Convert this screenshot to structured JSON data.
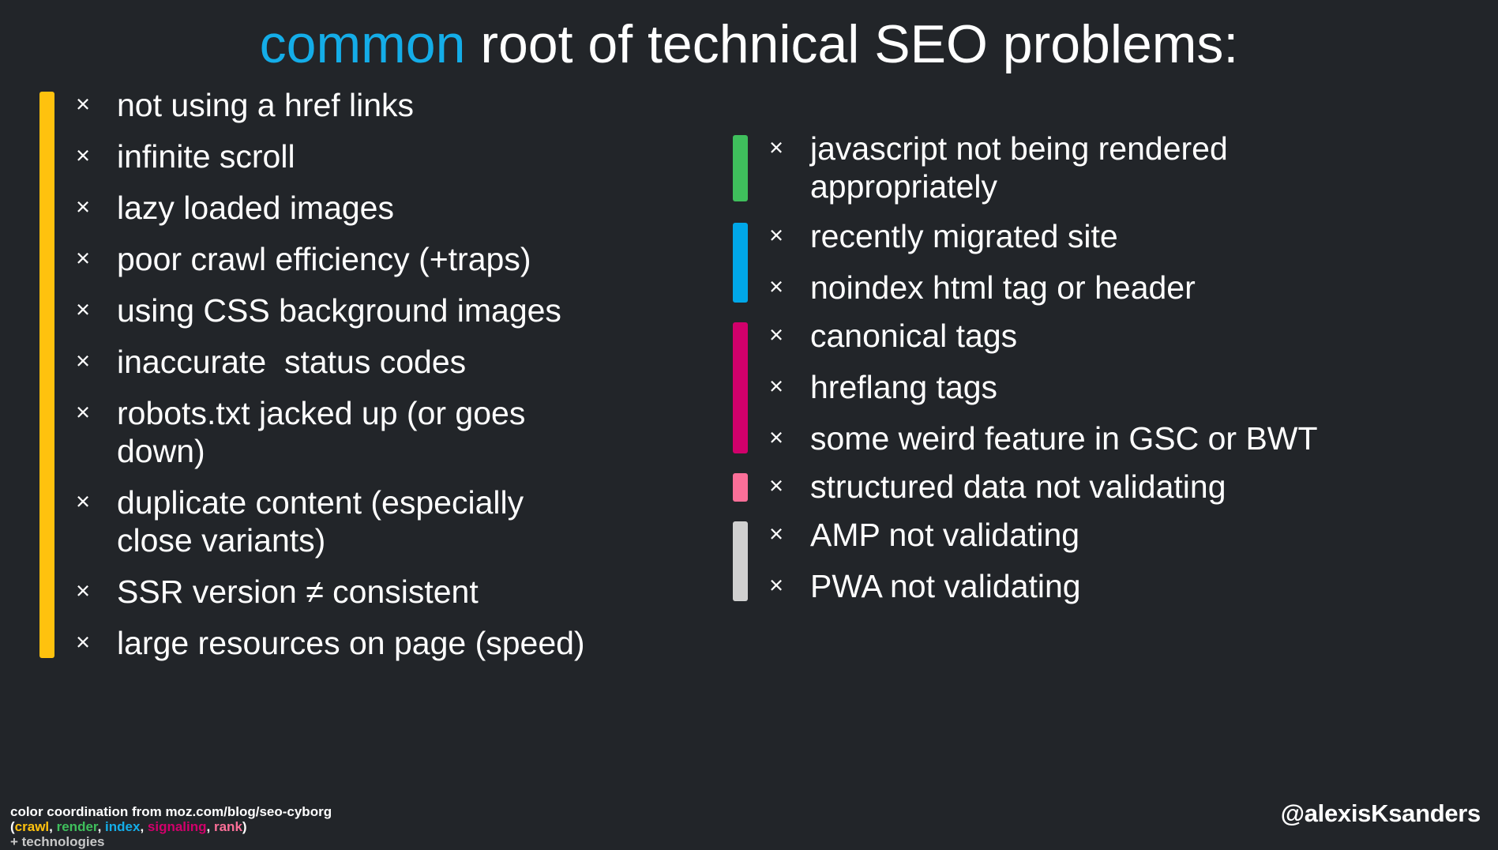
{
  "slide": {
    "background_color": "#222529",
    "title": {
      "highlight": "common",
      "rest": " root of technical SEO problems:",
      "highlight_color": "#14ADE8",
      "text_color": "#ffffff"
    },
    "bullet_mark": "×"
  },
  "left_column": {
    "groups": [
      {
        "bar_color": "#FFC20E",
        "bar_name": "crawl",
        "items": [
          "not using a href links",
          "infinite scroll",
          "lazy loaded images",
          "poor crawl efficiency (+traps)",
          "using CSS background images",
          "inaccurate  status codes",
          "robots.txt jacked up (or goes down)",
          "duplicate content (especially close variants)",
          "SSR version ≠ consistent",
          "large resources on page (speed)"
        ]
      }
    ]
  },
  "right_column": {
    "groups": [
      {
        "bar_color": "#3FBF5C",
        "bar_name": "render",
        "items": [
          "javascript not being rendered appropriately"
        ]
      },
      {
        "bar_color": "#00A7E8",
        "bar_name": "index",
        "items": [
          "recently migrated site",
          "noindex html tag or header"
        ]
      },
      {
        "bar_color": "#D1006B",
        "bar_name": "signaling",
        "items": [
          "canonical tags",
          "hreflang tags",
          "some weird feature in GSC or BWT"
        ]
      },
      {
        "bar_color": "#FB6F98",
        "bar_name": "rank",
        "items": [
          "structured data not validating"
        ]
      },
      {
        "bar_color": "#D0D0D0",
        "bar_name": "technologies",
        "items": [
          "AMP not validating",
          "PWA not validating"
        ]
      }
    ]
  },
  "footer": {
    "credit_prefix": "color coordination from moz.com/blog/seo-cyborg (",
    "credit_crawl": "crawl",
    "credit_sep1": ", ",
    "credit_render": "render",
    "credit_sep2": ", ",
    "credit_index": "index",
    "credit_sep3": ", ",
    "credit_signaling": "signaling",
    "credit_sep4": ", ",
    "credit_rank": "rank",
    "credit_suffix": ")",
    "credit_tech": "+ technologies",
    "handle": "@alexisKsanders"
  }
}
